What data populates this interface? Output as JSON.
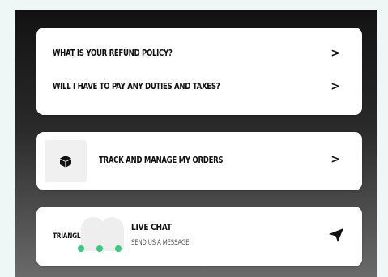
{
  "faq": {
    "items": [
      {
        "label": "WHAT IS YOUR REFUND POLICY?",
        "chevron": ">"
      },
      {
        "label": "WILL I HAVE TO PAY ANY DUTIES AND TAXES?",
        "chevron": ">"
      }
    ]
  },
  "orders": {
    "label": "TRACK AND MANAGE MY ORDERS",
    "chevron": ">",
    "icon": "package-box-icon"
  },
  "chat": {
    "brand": "TRIANGL",
    "title": "LIVE CHAT",
    "subtitle": "SEND US A MESSAGE",
    "icon": "send-icon",
    "status_color": "#2fce7a"
  }
}
